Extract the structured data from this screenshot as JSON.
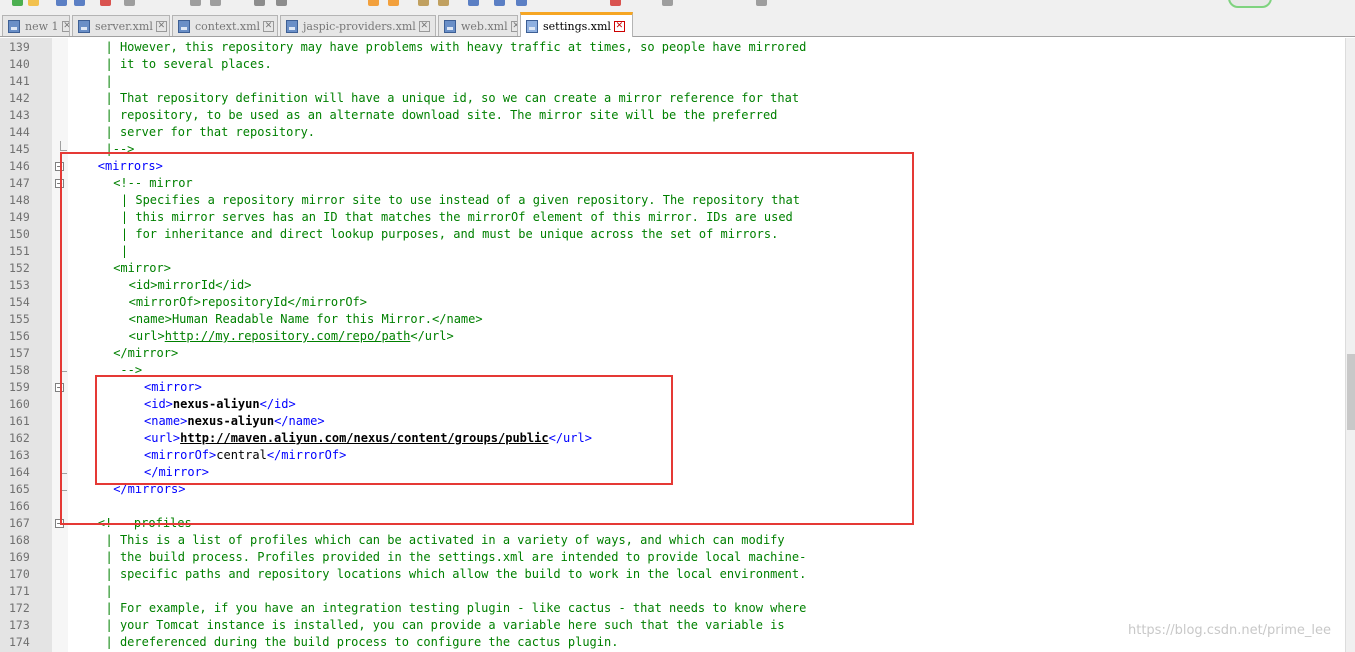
{
  "tabs": [
    {
      "label": "new 1",
      "active": false
    },
    {
      "label": "server.xml",
      "active": false
    },
    {
      "label": "context.xml",
      "active": false
    },
    {
      "label": "jaspic-providers.xml",
      "active": false
    },
    {
      "label": "web.xml",
      "active": false
    },
    {
      "label": "settings.xml",
      "active": true
    }
  ],
  "tab_close_glyph": "✕",
  "colors": {
    "comment": "#008000",
    "tag": "#0000ff",
    "text": "#000000",
    "highlight_box": "#e53935",
    "active_tab_accent": "#f6a623"
  },
  "lines": [
    {
      "n": "139",
      "indent": 5,
      "fold": "",
      "segs": [
        {
          "t": "| However, this repository may have problems with heavy traffic at times, so people have mirrored",
          "c": "comment"
        }
      ]
    },
    {
      "n": "140",
      "indent": 5,
      "fold": "",
      "segs": [
        {
          "t": "| it to several places.",
          "c": "comment"
        }
      ]
    },
    {
      "n": "141",
      "indent": 5,
      "fold": "",
      "segs": [
        {
          "t": "|",
          "c": "comment"
        }
      ]
    },
    {
      "n": "142",
      "indent": 5,
      "fold": "",
      "segs": [
        {
          "t": "| That repository definition will have a unique id, so we can create a mirror reference for that",
          "c": "comment"
        }
      ]
    },
    {
      "n": "143",
      "indent": 5,
      "fold": "",
      "segs": [
        {
          "t": "| repository, to be used as an alternate download site. The mirror site will be the preferred",
          "c": "comment"
        }
      ]
    },
    {
      "n": "144",
      "indent": 5,
      "fold": "",
      "segs": [
        {
          "t": "| server for that repository.",
          "c": "comment"
        }
      ]
    },
    {
      "n": "145",
      "indent": 5,
      "fold": "end",
      "segs": [
        {
          "t": "|-->",
          "c": "comment"
        }
      ]
    },
    {
      "n": "146",
      "indent": 4,
      "fold": "box",
      "segs": [
        {
          "t": "<mirrors>",
          "c": "tag"
        }
      ]
    },
    {
      "n": "147",
      "indent": 6,
      "fold": "box",
      "segs": [
        {
          "t": "<!-- mirror",
          "c": "comment"
        }
      ]
    },
    {
      "n": "148",
      "indent": 7,
      "fold": "",
      "segs": [
        {
          "t": "| Specifies a repository mirror site to use instead of a given repository. The repository that",
          "c": "comment"
        }
      ]
    },
    {
      "n": "149",
      "indent": 7,
      "fold": "",
      "segs": [
        {
          "t": "| this mirror serves has an ID that matches the mirrorOf element of this mirror. IDs are used",
          "c": "comment"
        }
      ]
    },
    {
      "n": "150",
      "indent": 7,
      "fold": "",
      "segs": [
        {
          "t": "| for inheritance and direct lookup purposes, and must be unique across the set of mirrors.",
          "c": "comment"
        }
      ]
    },
    {
      "n": "151",
      "indent": 7,
      "fold": "",
      "segs": [
        {
          "t": "|",
          "c": "comment"
        }
      ]
    },
    {
      "n": "152",
      "indent": 6,
      "fold": "",
      "segs": [
        {
          "t": "<mirror>",
          "c": "comment"
        }
      ]
    },
    {
      "n": "153",
      "indent": 8,
      "fold": "",
      "segs": [
        {
          "t": "<id>mirrorId</id>",
          "c": "comment"
        }
      ]
    },
    {
      "n": "154",
      "indent": 8,
      "fold": "",
      "segs": [
        {
          "t": "<mirrorOf>repositoryId</mirrorOf>",
          "c": "comment"
        }
      ]
    },
    {
      "n": "155",
      "indent": 8,
      "fold": "",
      "segs": [
        {
          "t": "<name>Human Readable Name for this Mirror.</name>",
          "c": "comment"
        }
      ]
    },
    {
      "n": "156",
      "indent": 8,
      "fold": "",
      "segs": [
        {
          "t": "<url>",
          "c": "comment"
        },
        {
          "t": "http://my.repository.com/repo/path",
          "c": "commentlink"
        },
        {
          "t": "</url>",
          "c": "comment"
        }
      ]
    },
    {
      "n": "157",
      "indent": 6,
      "fold": "",
      "segs": [
        {
          "t": "</mirror>",
          "c": "comment"
        }
      ]
    },
    {
      "n": "158",
      "indent": 6,
      "fold": "end",
      "segs": [
        {
          "t": " -->",
          "c": "comment"
        }
      ]
    },
    {
      "n": "159",
      "indent": 10,
      "fold": "box",
      "segs": [
        {
          "t": "<mirror>",
          "c": "tag"
        }
      ]
    },
    {
      "n": "160",
      "indent": 10,
      "fold": "",
      "segs": [
        {
          "t": "<id>",
          "c": "tag"
        },
        {
          "t": "nexus-aliyun",
          "c": "bold"
        },
        {
          "t": "</id>",
          "c": "tag"
        }
      ]
    },
    {
      "n": "161",
      "indent": 10,
      "fold": "",
      "segs": [
        {
          "t": "<name>",
          "c": "tag"
        },
        {
          "t": "nexus-aliyun",
          "c": "bold"
        },
        {
          "t": "</name>",
          "c": "tag"
        }
      ]
    },
    {
      "n": "162",
      "indent": 10,
      "fold": "",
      "segs": [
        {
          "t": "<url>",
          "c": "tag"
        },
        {
          "t": "http://maven.aliyun.com/nexus/content/groups/public",
          "c": "linkb"
        },
        {
          "t": "</url>",
          "c": "tag"
        }
      ]
    },
    {
      "n": "163",
      "indent": 10,
      "fold": "",
      "segs": [
        {
          "t": "<mirrorOf>",
          "c": "tag"
        },
        {
          "t": "central",
          "c": "text"
        },
        {
          "t": "</mirrorOf>",
          "c": "tag"
        }
      ]
    },
    {
      "n": "164",
      "indent": 10,
      "fold": "end",
      "segs": [
        {
          "t": "</mirror>",
          "c": "tag"
        }
      ]
    },
    {
      "n": "165",
      "indent": 6,
      "fold": "end",
      "segs": [
        {
          "t": "</mirrors>",
          "c": "tag"
        }
      ]
    },
    {
      "n": "166",
      "indent": 0,
      "fold": "",
      "segs": []
    },
    {
      "n": "167",
      "indent": 4,
      "fold": "box",
      "segs": [
        {
          "t": "<!-- profiles",
          "c": "comment"
        }
      ]
    },
    {
      "n": "168",
      "indent": 5,
      "fold": "",
      "segs": [
        {
          "t": "| This is a list of profiles which can be activated in a variety of ways, and which can modify",
          "c": "comment"
        }
      ]
    },
    {
      "n": "169",
      "indent": 5,
      "fold": "",
      "segs": [
        {
          "t": "| the build process. Profiles provided in the settings.xml are intended to provide local machine-",
          "c": "comment"
        }
      ]
    },
    {
      "n": "170",
      "indent": 5,
      "fold": "",
      "segs": [
        {
          "t": "| specific paths and repository locations which allow the build to work in the local environment.",
          "c": "comment"
        }
      ]
    },
    {
      "n": "171",
      "indent": 5,
      "fold": "",
      "segs": [
        {
          "t": "|",
          "c": "comment"
        }
      ]
    },
    {
      "n": "172",
      "indent": 5,
      "fold": "",
      "segs": [
        {
          "t": "| For example, if you have an integration testing plugin - like cactus - that needs to know where",
          "c": "comment"
        }
      ]
    },
    {
      "n": "173",
      "indent": 5,
      "fold": "",
      "segs": [
        {
          "t": "| your Tomcat instance is installed, you can provide a variable here such that the variable is",
          "c": "comment"
        }
      ]
    },
    {
      "n": "174",
      "indent": 5,
      "fold": "",
      "segs": [
        {
          "t": "| dereferenced during the build process to configure the cactus plugin.",
          "c": "comment"
        }
      ]
    }
  ],
  "watermark": "https://blog.csdn.net/prime_lee"
}
